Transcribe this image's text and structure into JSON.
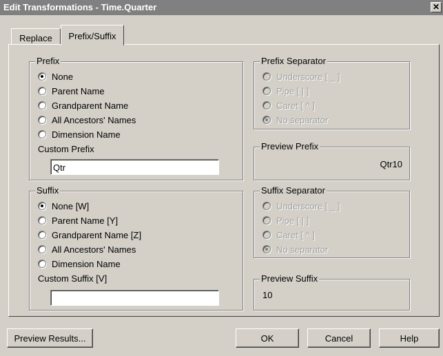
{
  "window": {
    "title": "Edit Transformations - Time.Quarter",
    "close_glyph": "✕"
  },
  "tabs": [
    {
      "label": "Replace",
      "active": false
    },
    {
      "label": "Prefix/Suffix",
      "active": true
    }
  ],
  "prefix": {
    "group_label": "Prefix",
    "options": [
      {
        "label": "None",
        "selected": true
      },
      {
        "label": "Parent Name",
        "selected": false
      },
      {
        "label": "Grandparent Name",
        "selected": false
      },
      {
        "label": "All Ancestors' Names",
        "selected": false
      },
      {
        "label": "Dimension Name",
        "selected": false
      }
    ],
    "custom_label": "Custom Prefix",
    "custom_value": "Qtr"
  },
  "prefix_separator": {
    "group_label": "Prefix Separator",
    "options": [
      {
        "label": "Underscore [ _ ]",
        "selected": false
      },
      {
        "label": "Pipe [ | ]",
        "selected": false
      },
      {
        "label": "Caret [ ^ ]",
        "selected": false
      },
      {
        "label": "No separator",
        "selected": true
      }
    ]
  },
  "preview_prefix": {
    "group_label": "Preview Prefix",
    "value": "Qtr10"
  },
  "suffix": {
    "group_label": "Suffix",
    "options": [
      {
        "label": "None [W]",
        "selected": true
      },
      {
        "label": "Parent Name [Y]",
        "selected": false
      },
      {
        "label": "Grandparent Name [Z]",
        "selected": false
      },
      {
        "label": "All Ancestors' Names",
        "selected": false
      },
      {
        "label": "Dimension Name",
        "selected": false
      }
    ],
    "custom_label": "Custom Suffix [V]",
    "custom_value": ""
  },
  "suffix_separator": {
    "group_label": "Suffix Separator",
    "options": [
      {
        "label": "Underscore [ _ ]",
        "selected": false
      },
      {
        "label": "Pipe [ | ]",
        "selected": false
      },
      {
        "label": "Caret [ ^ ]",
        "selected": false
      },
      {
        "label": "No separator",
        "selected": true
      }
    ]
  },
  "preview_suffix": {
    "group_label": "Preview Suffix",
    "value": "10"
  },
  "buttons": {
    "preview_results": "Preview Results...",
    "ok": "OK",
    "cancel": "Cancel",
    "help": "Help"
  }
}
